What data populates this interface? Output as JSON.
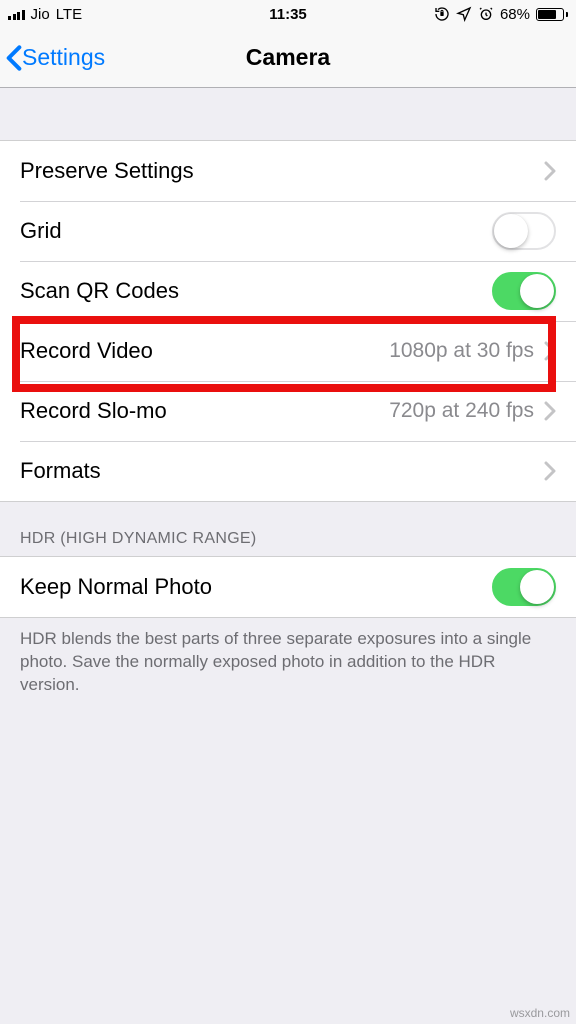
{
  "status": {
    "carrier": "Jio",
    "network": "LTE",
    "time": "11:35",
    "battery_pct": "68%"
  },
  "nav": {
    "back_label": "Settings",
    "title": "Camera"
  },
  "rows": {
    "preserve": {
      "label": "Preserve Settings"
    },
    "grid": {
      "label": "Grid",
      "on": false
    },
    "qr": {
      "label": "Scan QR Codes",
      "on": true
    },
    "record_video": {
      "label": "Record Video",
      "value": "1080p at 30 fps"
    },
    "record_slomo": {
      "label": "Record Slo-mo",
      "value": "720p at 240 fps"
    },
    "formats": {
      "label": "Formats"
    },
    "keep_normal": {
      "label": "Keep Normal Photo",
      "on": true
    }
  },
  "hdr": {
    "header": "HDR (HIGH DYNAMIC RANGE)",
    "footer": "HDR blends the best parts of three separate exposures into a single photo. Save the normally exposed photo in addition to the HDR version."
  },
  "watermark": "wsxdn.com"
}
